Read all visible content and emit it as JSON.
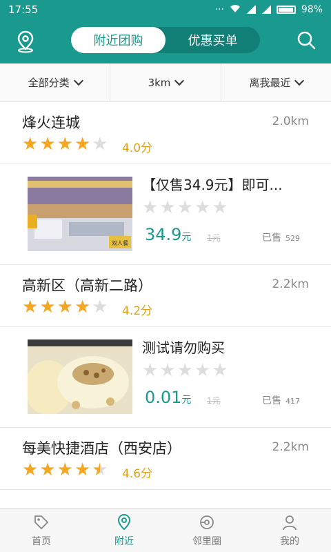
{
  "status": {
    "time": "17:55",
    "battery": "98%"
  },
  "header": {
    "tabs": [
      {
        "label": "附近团购",
        "active": true
      },
      {
        "label": "优惠买单",
        "active": false
      }
    ]
  },
  "filters": [
    {
      "label": "全部分类"
    },
    {
      "label": "3km"
    },
    {
      "label": "离我最近"
    }
  ],
  "stores": [
    {
      "name": "烽火连城",
      "distance": "2.0km",
      "rating": 4.0,
      "score_text": "4.0分"
    },
    {
      "name": "高新区（高新二路）",
      "distance": "2.2km",
      "rating": 4.2,
      "score_text": "4.2分"
    },
    {
      "name": "每美快捷酒店（西安店）",
      "distance": "2.2km",
      "rating": 4.6,
      "score_text": "4.6分"
    }
  ],
  "deals": [
    {
      "title": "【仅售34.9元】即可...",
      "price": "34.9",
      "unit": "元",
      "original": "1元",
      "sold_label": "已售",
      "sold_count": "529",
      "badge": "双人餐"
    },
    {
      "title": "测试请勿购买",
      "price": "0.01",
      "unit": "元",
      "original": "1元",
      "sold_label": "已售",
      "sold_count": "417"
    }
  ],
  "tabbar": [
    {
      "label": "首页",
      "icon": "tag-icon",
      "active": false
    },
    {
      "label": "附近",
      "icon": "location-icon",
      "active": true
    },
    {
      "label": "邻里圈",
      "icon": "community-icon",
      "active": false
    },
    {
      "label": "我的",
      "icon": "person-icon",
      "active": false
    }
  ],
  "colors": {
    "primary": "#1a9a8f",
    "star": "#f5a623",
    "score": "#e3a01b"
  }
}
